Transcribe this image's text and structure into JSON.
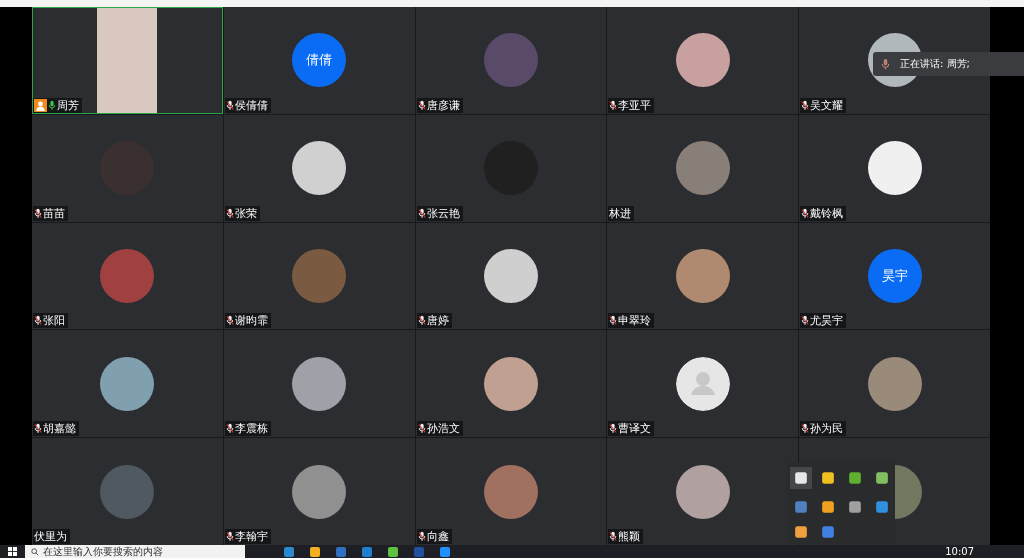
{
  "tiles": [
    {
      "name": "周芳",
      "kind": "video",
      "muted": false,
      "host": true,
      "speaking": true
    },
    {
      "name": "侯倩倩",
      "kind": "initials",
      "label": "倩倩",
      "muted": true,
      "host": false,
      "speaking": false
    },
    {
      "name": "唐彦谦",
      "kind": "photo",
      "muted": true,
      "host": false,
      "speaking": false
    },
    {
      "name": "李亚平",
      "kind": "photo",
      "muted": true,
      "host": false,
      "speaking": false
    },
    {
      "name": "吴文耀",
      "kind": "photo",
      "muted": true,
      "host": false,
      "speaking": false
    },
    {
      "name": "苗苗",
      "kind": "photo",
      "muted": true,
      "host": false,
      "speaking": false
    },
    {
      "name": "张荣",
      "kind": "photo",
      "muted": true,
      "host": false,
      "speaking": false
    },
    {
      "name": "张云艳",
      "kind": "photo",
      "muted": true,
      "host": false,
      "speaking": false
    },
    {
      "name": "林进",
      "kind": "photo",
      "host": false,
      "speaking": false
    },
    {
      "name": "戴铃枫",
      "kind": "photo",
      "muted": true,
      "host": false,
      "speaking": false
    },
    {
      "name": "张阳",
      "kind": "photo",
      "muted": true,
      "host": false,
      "speaking": false
    },
    {
      "name": "谢昀霏",
      "kind": "photo",
      "muted": true,
      "host": false,
      "speaking": false
    },
    {
      "name": "唐婷",
      "kind": "photo",
      "muted": true,
      "host": false,
      "speaking": false
    },
    {
      "name": "申翠玲",
      "kind": "photo",
      "muted": true,
      "host": false,
      "speaking": false
    },
    {
      "name": "尤昊宇",
      "kind": "initials",
      "label": "昊宇",
      "muted": true,
      "host": false,
      "speaking": false
    },
    {
      "name": "胡嘉懿",
      "kind": "photo",
      "muted": true,
      "host": false,
      "speaking": false
    },
    {
      "name": "李震栋",
      "kind": "photo",
      "muted": true,
      "host": false,
      "speaking": false
    },
    {
      "name": "孙浩文",
      "kind": "photo",
      "muted": true,
      "host": false,
      "speaking": false
    },
    {
      "name": "曹译文",
      "kind": "default",
      "muted": true,
      "host": false,
      "speaking": false
    },
    {
      "name": "孙为民",
      "kind": "photo",
      "muted": true,
      "host": false,
      "speaking": false
    },
    {
      "name": "伏里为",
      "kind": "photo",
      "host": false,
      "speaking": false
    },
    {
      "name": "李翰宇",
      "kind": "photo",
      "muted": true,
      "host": false,
      "speaking": false
    },
    {
      "name": "向鑫",
      "kind": "photo",
      "muted": true,
      "host": false,
      "speaking": false
    },
    {
      "name": "熊颖",
      "kind": "photo",
      "muted": true,
      "host": false,
      "speaking": false
    },
    {
      "kind": "photo",
      "host": false,
      "speaking": false
    }
  ],
  "speaking_toast": {
    "text": "正在讲话: 周芳;"
  },
  "taskbar": {
    "search": {
      "placeholder": "在这里输入你要搜索的内容"
    },
    "time": "10:07"
  }
}
